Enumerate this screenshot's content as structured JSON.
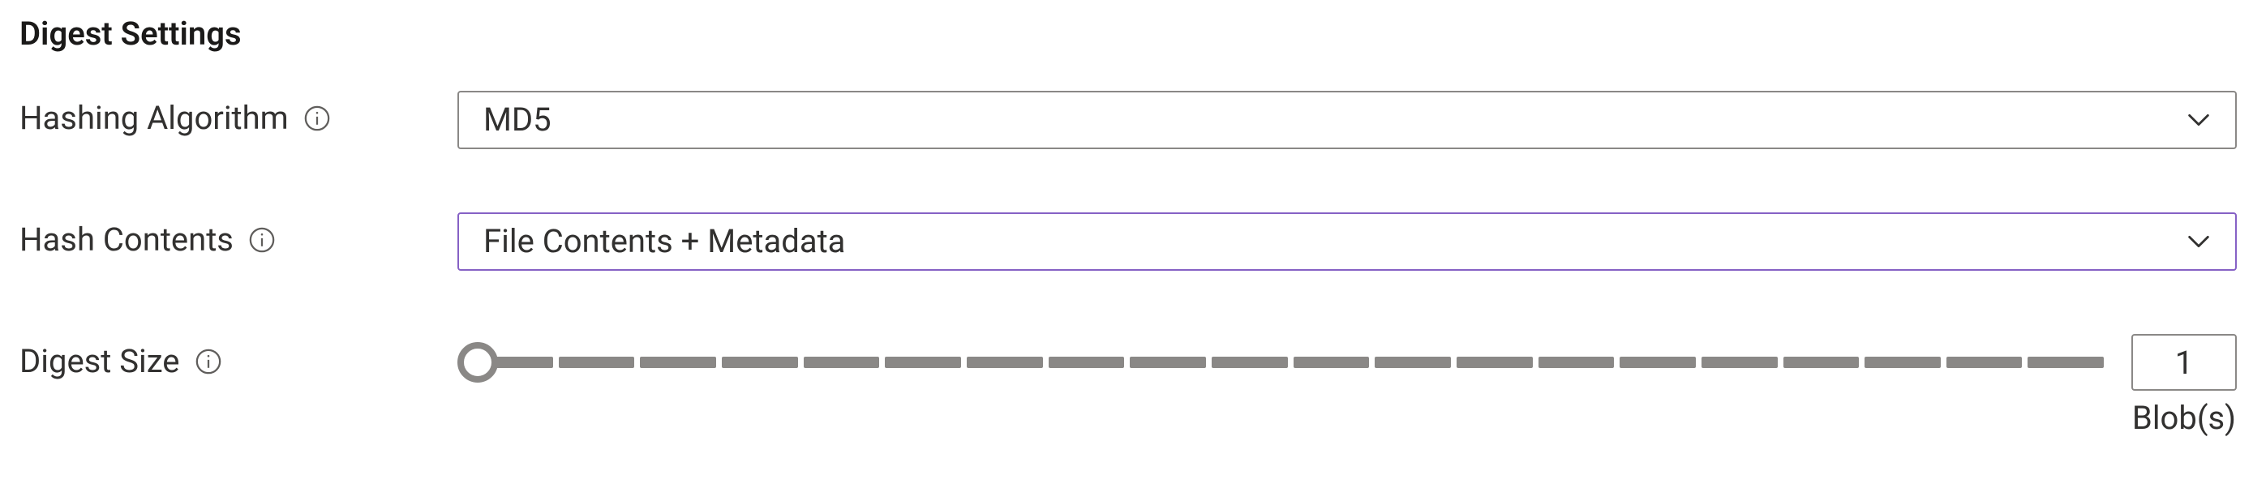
{
  "section": {
    "title": "Digest Settings"
  },
  "fields": {
    "algorithm": {
      "label": "Hashing Algorithm",
      "value": "MD5"
    },
    "contents": {
      "label": "Hash Contents",
      "value": "File Contents + Metadata"
    },
    "size": {
      "label": "Digest Size",
      "value": "1",
      "unit": "Blob(s)",
      "ticks": 20
    }
  }
}
